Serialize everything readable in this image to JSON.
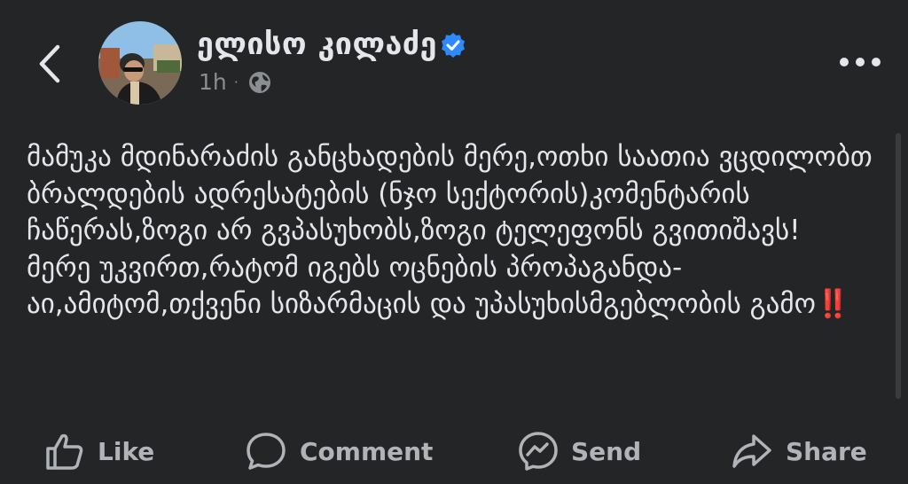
{
  "header": {
    "author_name": "ელისო კილაძე",
    "timestamp": "1h",
    "separator": "·",
    "visibility_icon": "globe-icon",
    "verified_icon": "verified-badge-icon",
    "back_icon": "chevron-left-icon",
    "more_icon": "more-horizontal-icon",
    "verified_color": "#2e89ff"
  },
  "post": {
    "text": "მამუკა მდინარაძის განცხადების მერე,ოთხი საათია ვცდილობთ ბრალდების ადრესატების (ნჯო სექტორის)კომენტარის ჩაწერას,ზოგი არ გვპასუხობს,ზოგი ტელეფონს გვითიშავს!\nმერე უკვირთ,რატომ იგებს ოცნების პროპაგანდა-აი,ამიტომ,თქვენი სიზარმაცის და უპასუხისმგებლობის გამო",
    "emphasis": "‼️",
    "emphasis_color": "#e0242a"
  },
  "actions": [
    {
      "label": "Like",
      "icon": "thumbs-up-icon"
    },
    {
      "label": "Comment",
      "icon": "comment-icon"
    },
    {
      "label": "Send",
      "icon": "messenger-icon"
    },
    {
      "label": "Share",
      "icon": "share-icon"
    }
  ],
  "colors": {
    "background": "#242526",
    "text": "#e4e6eb",
    "secondary_text": "#b0b3b8"
  }
}
